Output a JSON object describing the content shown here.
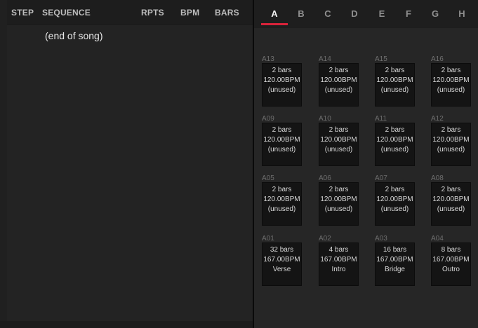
{
  "song": {
    "columns": {
      "step": "STEP",
      "sequence": "SEQUENCE",
      "rpts": "RPTS",
      "bpm": "BPM",
      "bars": "BARS"
    },
    "rows": [
      {
        "sequence": "(end of song)"
      }
    ]
  },
  "tabs": {
    "items": [
      "A",
      "B",
      "C",
      "D",
      "E",
      "F",
      "G",
      "H"
    ],
    "active": "A"
  },
  "colors": {
    "accent": "#d9233a"
  },
  "sequences": [
    {
      "id": "A13",
      "bars": "2 bars",
      "bpm": "120.00BPM",
      "name": "(unused)"
    },
    {
      "id": "A14",
      "bars": "2 bars",
      "bpm": "120.00BPM",
      "name": "(unused)"
    },
    {
      "id": "A15",
      "bars": "2 bars",
      "bpm": "120.00BPM",
      "name": "(unused)"
    },
    {
      "id": "A16",
      "bars": "2 bars",
      "bpm": "120.00BPM",
      "name": "(unused)"
    },
    {
      "id": "A09",
      "bars": "2 bars",
      "bpm": "120.00BPM",
      "name": "(unused)"
    },
    {
      "id": "A10",
      "bars": "2 bars",
      "bpm": "120.00BPM",
      "name": "(unused)"
    },
    {
      "id": "A11",
      "bars": "2 bars",
      "bpm": "120.00BPM",
      "name": "(unused)"
    },
    {
      "id": "A12",
      "bars": "2 bars",
      "bpm": "120.00BPM",
      "name": "(unused)"
    },
    {
      "id": "A05",
      "bars": "2 bars",
      "bpm": "120.00BPM",
      "name": "(unused)"
    },
    {
      "id": "A06",
      "bars": "2 bars",
      "bpm": "120.00BPM",
      "name": "(unused)"
    },
    {
      "id": "A07",
      "bars": "2 bars",
      "bpm": "120.00BPM",
      "name": "(unused)"
    },
    {
      "id": "A08",
      "bars": "2 bars",
      "bpm": "120.00BPM",
      "name": "(unused)"
    },
    {
      "id": "A01",
      "bars": "32 bars",
      "bpm": "167.00BPM",
      "name": "Verse"
    },
    {
      "id": "A02",
      "bars": "4 bars",
      "bpm": "167.00BPM",
      "name": "Intro"
    },
    {
      "id": "A03",
      "bars": "16 bars",
      "bpm": "167.00BPM",
      "name": "Bridge"
    },
    {
      "id": "A04",
      "bars": "8 bars",
      "bpm": "167.00BPM",
      "name": "Outro"
    }
  ]
}
